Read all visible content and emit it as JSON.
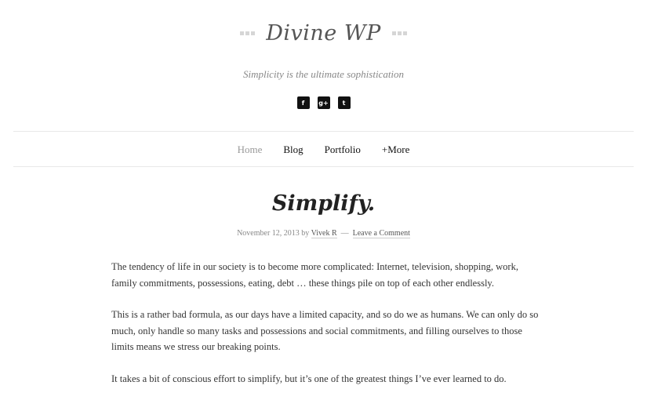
{
  "site": {
    "title": "Divine WP",
    "tagline": "Simplicity is the ultimate sophistication"
  },
  "social": [
    {
      "icon": "facebook-icon",
      "glyph": "f"
    },
    {
      "icon": "google-plus-icon",
      "glyph": "g+"
    },
    {
      "icon": "twitter-icon",
      "glyph": "t"
    }
  ],
  "nav": {
    "home": "Home",
    "blog": "Blog",
    "portfolio": "Portfolio",
    "more": "+More"
  },
  "post": {
    "title": "Simplify.",
    "date": "November 12, 2013",
    "by": "by",
    "author": "Vivek R",
    "separator": "—",
    "comment_link": "Leave a Comment",
    "paragraphs": [
      "The tendency of life in our society is to become more complicated: Internet, television, shopping, work, family commitments, possessions, eating, debt … these things pile on top of each other endlessly.",
      "This is a rather bad formula, as our days have a limited capacity, and so do we as humans. We can only do so much, only handle so many tasks and possessions and social commitments, and filling ourselves to those limits means we stress our breaking points.",
      "It takes a bit of conscious effort to simplify, but it’s one of the greatest things I’ve ever learned to do."
    ]
  }
}
